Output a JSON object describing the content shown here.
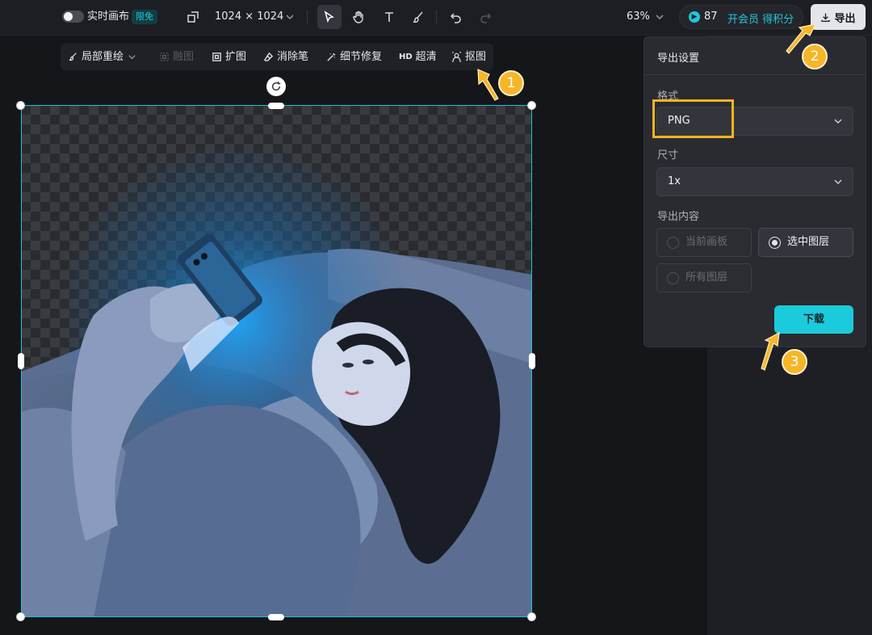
{
  "topbar": {
    "realtime_label": "实时画布",
    "limited_free_badge": "限免",
    "canvas_size": "1024 × 1024",
    "zoom": "63%",
    "credits": "87",
    "member_label": "开会员 得积分",
    "export_label": "导出"
  },
  "subbar": {
    "inpaint": "局部重绘",
    "blend": "融图",
    "expand": "扩图",
    "eraser": "消除笔",
    "detail_fix": "细节修复",
    "hd_prefix": "HD",
    "hd_label": "超清",
    "matting": "抠图"
  },
  "export_panel": {
    "title": "导出设置",
    "format_label": "格式",
    "format_value": "PNG",
    "size_label": "尺寸",
    "size_value": "1x",
    "content_label": "导出内容",
    "options": [
      "当前画板",
      "选中图层",
      "所有图层"
    ],
    "selected_option": "选中图层",
    "download_label": "下载"
  },
  "annotations": {
    "step1": "1",
    "step2": "2",
    "step3": "3"
  },
  "colors": {
    "accent": "#1ccbdb",
    "highlight": "#f4b41f",
    "selection": "#19c3d2"
  }
}
